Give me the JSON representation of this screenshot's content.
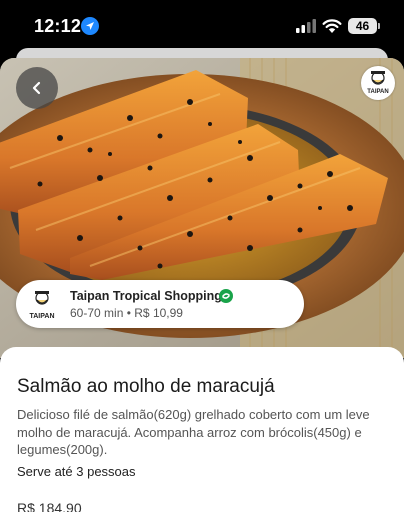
{
  "status_bar": {
    "time": "12:12",
    "battery": "46"
  },
  "nav": {
    "back_icon": "chevron-left-icon"
  },
  "brand": {
    "logo_text": "TAIPAN"
  },
  "store": {
    "name": "Taipan Tropical Shopping",
    "logo_text": "TAIPAN",
    "delivery_time": "60-70 min",
    "separator": "•",
    "delivery_fee": "R$ 10,99",
    "verified_color": "#19a34a"
  },
  "product": {
    "title": "Salmão ao molho de maracujá",
    "description": "Delicioso filé de salmão(620g) grelhado coberto  com um leve molho de maracujá. Acompanha arroz com brócolis(450g) e legumes(200g).",
    "serves": "Serve até 3 pessoas",
    "price": "R$ 184,90"
  }
}
